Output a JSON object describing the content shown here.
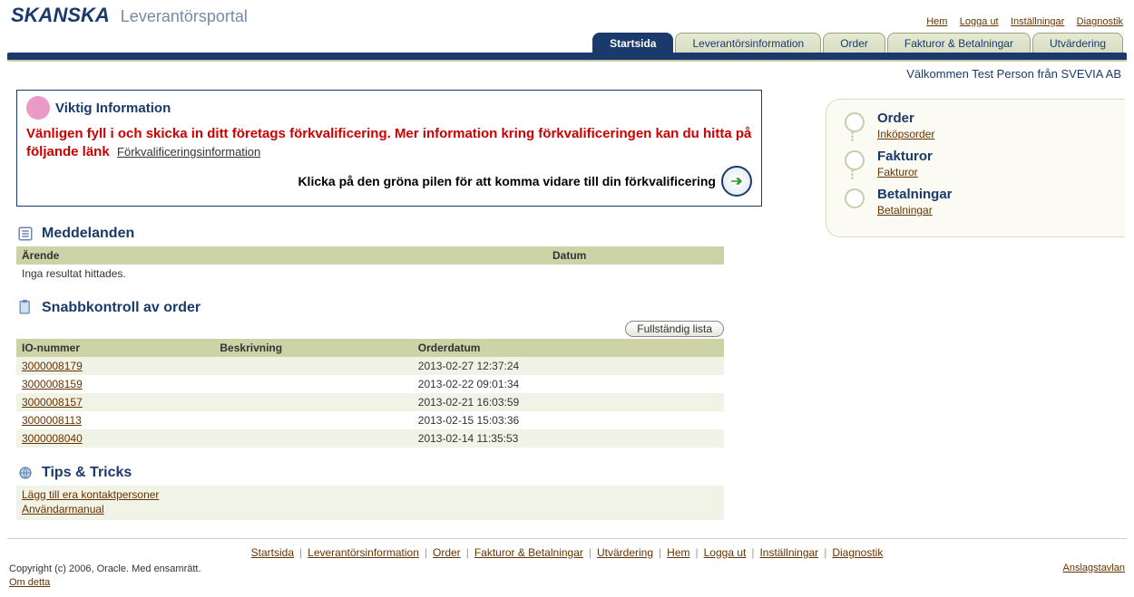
{
  "brand": {
    "name": "SKANSKA",
    "sub": "Leverantörsportal"
  },
  "top_links": [
    "Hem",
    "Logga ut",
    "Inställningar",
    "Diagnostik"
  ],
  "tabs": [
    {
      "label": "Startsida",
      "active": true
    },
    {
      "label": "Leverantörsinformation",
      "active": false
    },
    {
      "label": "Order",
      "active": false
    },
    {
      "label": "Fakturor & Betalningar",
      "active": false
    },
    {
      "label": "Utvärdering",
      "active": false
    }
  ],
  "welcome": "Välkommen Test Person från SVEVIA AB",
  "info": {
    "title": "Viktig Information",
    "warning": "Vänligen fyll i och skicka in ditt företags förkvalificering. Mer information kring förkvalificeringen kan du hitta på följande länk",
    "warning_link": "Förkvalificeringsinformation",
    "action": "Klicka på den gröna pilen för att komma vidare till din förkvalificering"
  },
  "messages": {
    "title": "Meddelanden",
    "cols": [
      "Ärende",
      "Datum"
    ],
    "empty": "Inga resultat hittades."
  },
  "orders": {
    "title": "Snabbkontroll av order",
    "full_list": "Fullständig lista",
    "cols": [
      "IO-nummer",
      "Beskrivning",
      "Orderdatum"
    ],
    "rows": [
      {
        "io": "3000008179",
        "desc": "",
        "date": "2013-02-27 12:37:24"
      },
      {
        "io": "3000008159",
        "desc": "",
        "date": "2013-02-22 09:01:34"
      },
      {
        "io": "3000008157",
        "desc": "",
        "date": "2013-02-21 16:03:59"
      },
      {
        "io": "3000008113",
        "desc": "",
        "date": "2013-02-15 15:03:36"
      },
      {
        "io": "3000008040",
        "desc": "",
        "date": "2013-02-14 11:35:53"
      }
    ]
  },
  "tips": {
    "title": "Tips & Tricks",
    "links": [
      "Lägg till era kontaktpersoner",
      "Användarmanual"
    ]
  },
  "side": [
    {
      "head": "Order",
      "link": "Inköpsorder"
    },
    {
      "head": "Fakturor",
      "link": "Fakturor"
    },
    {
      "head": "Betalningar",
      "link": "Betalningar"
    }
  ],
  "footer_links": [
    "Startsida",
    "Leverantörsinformation",
    "Order",
    "Fakturor & Betalningar",
    "Utvärdering",
    "Hem",
    "Logga ut",
    "Inställningar",
    "Diagnostik"
  ],
  "copyright": "Copyright (c) 2006, Oracle. Med ensamrätt.",
  "about": "Om detta",
  "board": "Anslagstavlan"
}
